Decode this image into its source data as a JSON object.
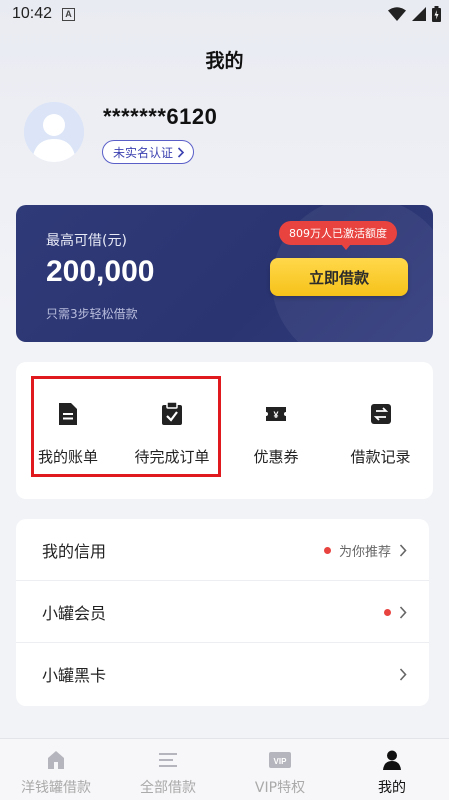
{
  "status_bar": {
    "time": "10:42",
    "a_icon": "A"
  },
  "page": {
    "title": "我的"
  },
  "profile": {
    "username": "*******6120",
    "verify_label": "未实名认证"
  },
  "loan_card": {
    "label": "最高可借(元)",
    "amount": "200,000",
    "sub": "只需3步轻松借款",
    "badge": "809万人已激活额度",
    "button": "立即借款"
  },
  "quick_actions": [
    {
      "label": "我的账单",
      "icon": "bill-icon"
    },
    {
      "label": "待完成订单",
      "icon": "clipboard-check-icon"
    },
    {
      "label": "优惠券",
      "icon": "coupon-icon"
    },
    {
      "label": "借款记录",
      "icon": "transfer-record-icon"
    }
  ],
  "menu": [
    {
      "title": "我的信用",
      "hint": "为你推荐",
      "has_dot": true
    },
    {
      "title": "小罐会员",
      "hint": "",
      "has_dot": true
    },
    {
      "title": "小罐黑卡",
      "hint": "",
      "has_dot": false
    }
  ],
  "bottom_nav": [
    {
      "label": "洋钱罐借款",
      "icon": "home-icon",
      "active": false
    },
    {
      "label": "全部借款",
      "icon": "list-icon",
      "active": false
    },
    {
      "label": "VIP特权",
      "icon": "vip-icon",
      "icon_text": "VIP",
      "active": false
    },
    {
      "label": "我的",
      "icon": "user-icon",
      "active": true
    }
  ],
  "colors": {
    "card_bg": "#2f3a78",
    "button_yellow": "#f6c21a",
    "badge_red": "#e8433f",
    "highlight_red": "#e0191e",
    "verify_purple": "#3c42b0"
  }
}
